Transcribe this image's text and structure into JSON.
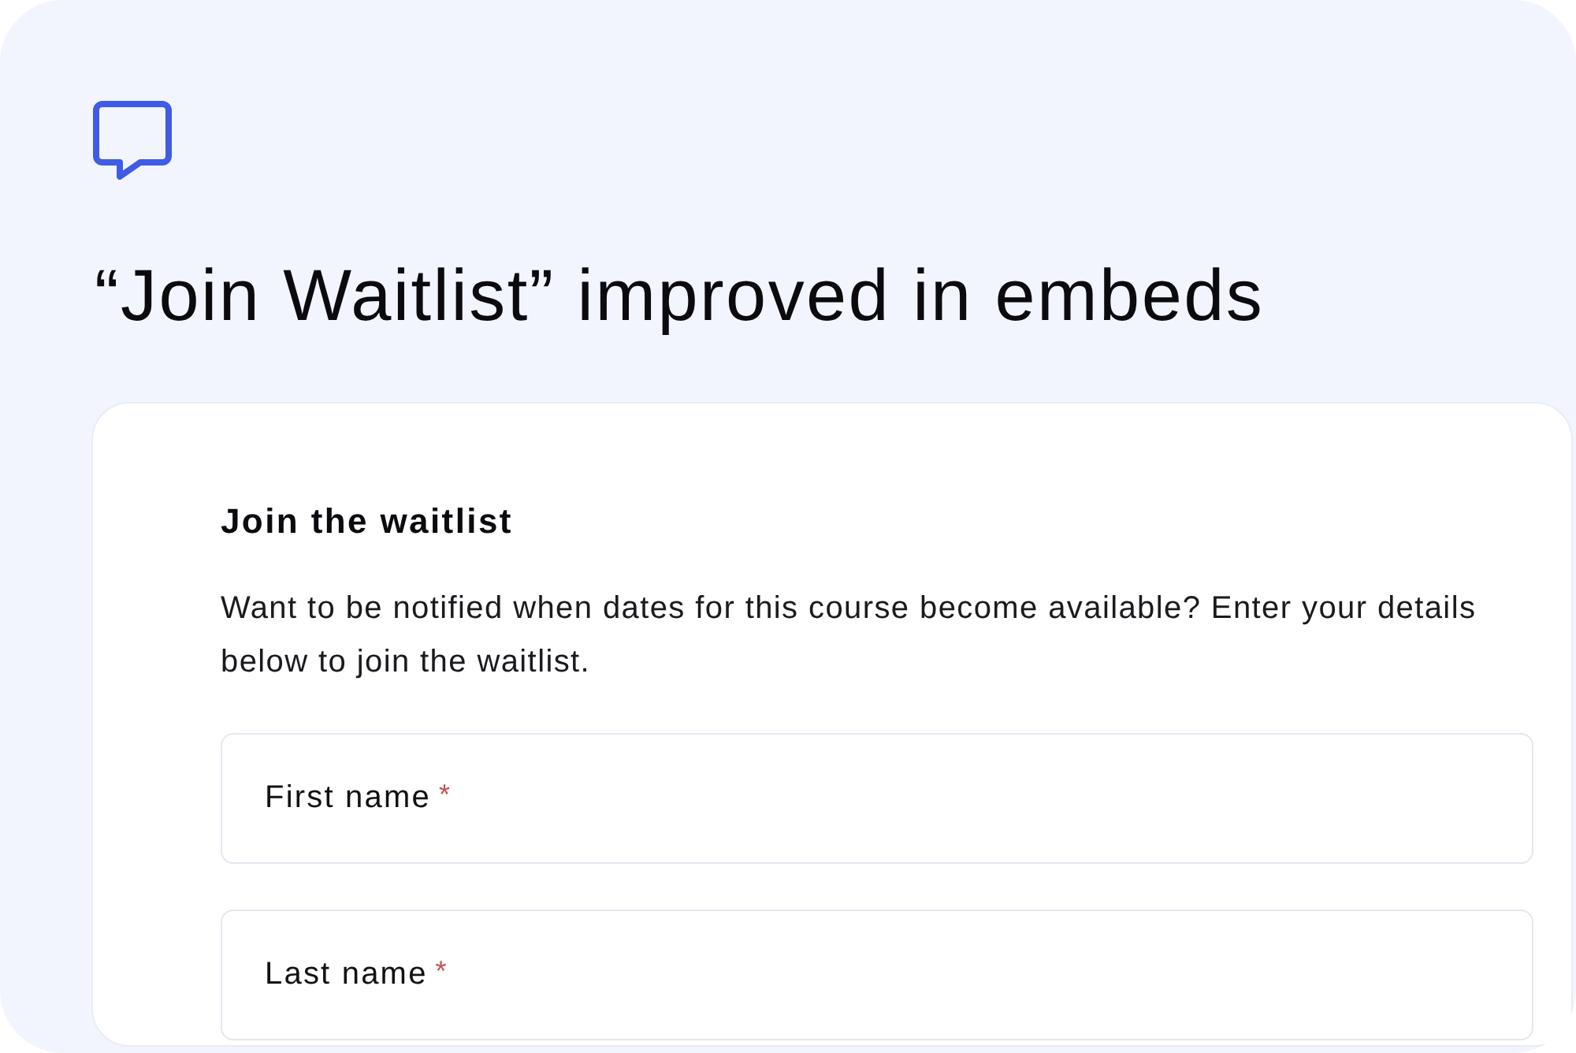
{
  "header": {
    "title": "“Join Waitlist” improved in embeds"
  },
  "form": {
    "heading": "Join the waitlist",
    "description": "Want to be notified when dates for this course become available? Enter your details below to join the waitlist.",
    "fields": [
      {
        "label": "First name",
        "required_marker": "*"
      },
      {
        "label": "Last name",
        "required_marker": "*"
      }
    ]
  }
}
